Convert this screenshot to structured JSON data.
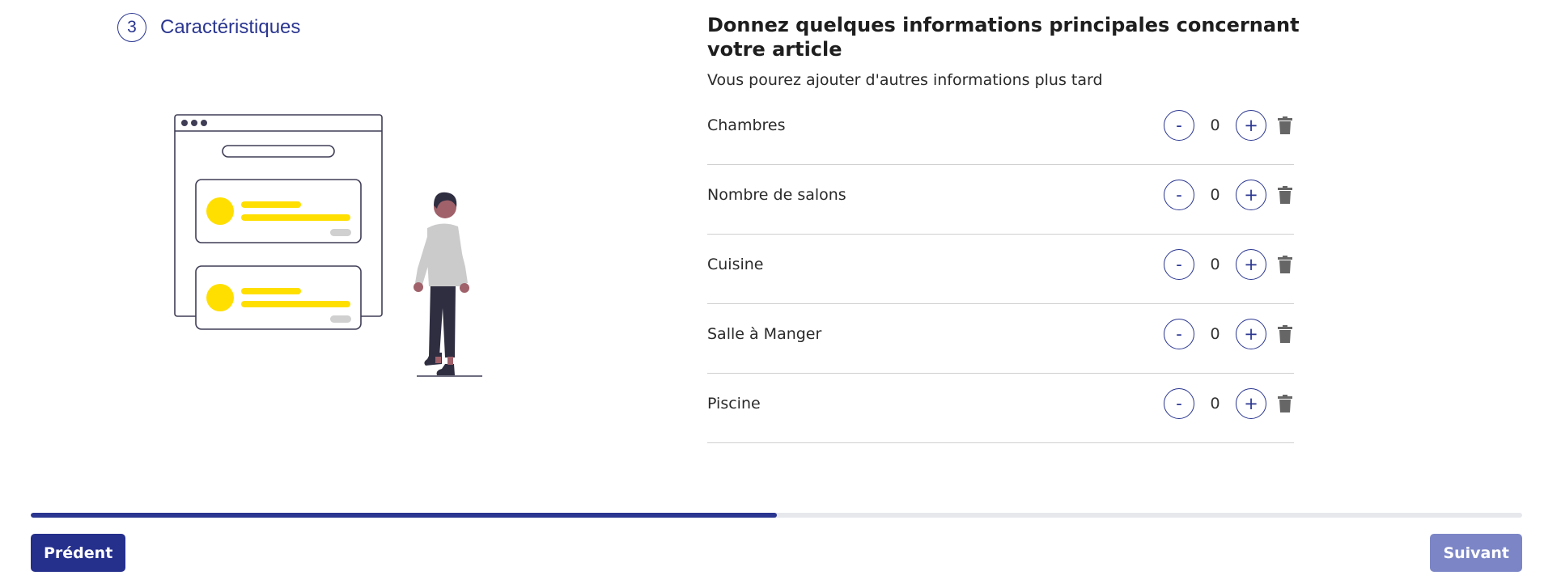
{
  "step": {
    "number": "3",
    "label": "Caractéristiques"
  },
  "form": {
    "title": "Donnez quelques informations principales concernant votre article",
    "subtitle": "Vous pourez ajouter d'autres informations plus tard",
    "rows": [
      {
        "label": "Chambres",
        "value": "0"
      },
      {
        "label": "Nombre de salons",
        "value": "0"
      },
      {
        "label": "Cuisine",
        "value": "0"
      },
      {
        "label": "Salle à Manger",
        "value": "0"
      },
      {
        "label": "Piscine",
        "value": "0"
      }
    ],
    "minus_symbol": "-",
    "plus_symbol": "+",
    "icons": {
      "delete": "trash-icon"
    }
  },
  "progress": {
    "fraction": 0.5
  },
  "footer": {
    "prev_label": "Prédent",
    "next_label": "Suivant"
  },
  "colors": {
    "primary": "#2a3690",
    "primary_dark": "#252f8c",
    "next_disabled": "#7c86c6",
    "accent_yellow": "#ffdf00",
    "trash": "#666666"
  }
}
